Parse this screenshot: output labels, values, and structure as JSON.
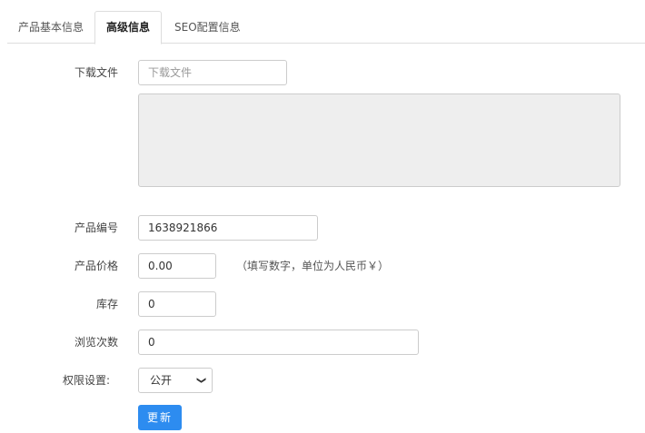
{
  "tabs": [
    {
      "label": "产品基本信息",
      "active": false
    },
    {
      "label": "高级信息",
      "active": true
    },
    {
      "label": "SEO配置信息",
      "active": false
    }
  ],
  "form": {
    "download": {
      "label": "下载文件",
      "placeholder": "下载文件",
      "value": ""
    },
    "product_no": {
      "label": "产品编号",
      "value": "1638921866"
    },
    "price": {
      "label": "产品价格",
      "value": "0.00",
      "hint": "（填写数字，单位为人民币￥）"
    },
    "stock": {
      "label": "库存",
      "value": "0"
    },
    "views": {
      "label": "浏览次数",
      "value": "0"
    },
    "permission": {
      "label": "权限设置:",
      "selected": "公开"
    },
    "submit_label": "更新"
  },
  "colors": {
    "accent": "#2d8cf0",
    "textarea_bg": "#eeeeee",
    "border": "#cccccc"
  }
}
